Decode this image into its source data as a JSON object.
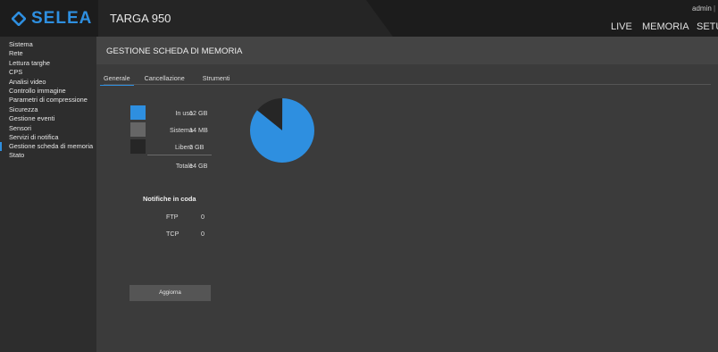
{
  "app": {
    "brand": "SELEA",
    "model": "TARGA 950",
    "user": "admin",
    "brand_color": "#2e8fe0"
  },
  "nav": {
    "live": "LIVE",
    "memoria": "MEMORIA",
    "setup": "SETUP"
  },
  "sidebar": {
    "items": [
      {
        "label": "Sistema"
      },
      {
        "label": "Rete"
      },
      {
        "label": "Lettura targhe"
      },
      {
        "label": "CPS"
      },
      {
        "label": "Analisi video"
      },
      {
        "label": "Controllo immagine"
      },
      {
        "label": "Parametri di compressione"
      },
      {
        "label": "Sicurezza"
      },
      {
        "label": "Gestione eventi"
      },
      {
        "label": "Sensori"
      },
      {
        "label": "Servizi di notifica"
      },
      {
        "label": "Gestione scheda di memoria",
        "active": true
      },
      {
        "label": "Stato"
      }
    ]
  },
  "page": {
    "title": "GESTIONE SCHEDA DI MEMORIA",
    "tabs": [
      {
        "label": "Generale",
        "active": true
      },
      {
        "label": "Cancellazione"
      },
      {
        "label": "Strumenti"
      }
    ]
  },
  "storage": {
    "in_use_label": "In uso",
    "in_use_value": "12 GB",
    "in_use_color": "#2e8fe0",
    "system_label": "Sistema",
    "system_value": "14 MB",
    "system_color": "#666666",
    "free_label": "Libero",
    "free_value": "2 GB",
    "free_color": "#262626",
    "total_label": "Totale",
    "total_value": "14 GB",
    "in_use_fraction": 0.857,
    "system_fraction": 0.001,
    "free_fraction": 0.143
  },
  "queue": {
    "title": "Notifiche in coda",
    "ftp_label": "FTP",
    "ftp_value": "0",
    "tcp_label": "TCP",
    "tcp_value": "0"
  },
  "actions": {
    "refresh": "Aggiorna"
  }
}
